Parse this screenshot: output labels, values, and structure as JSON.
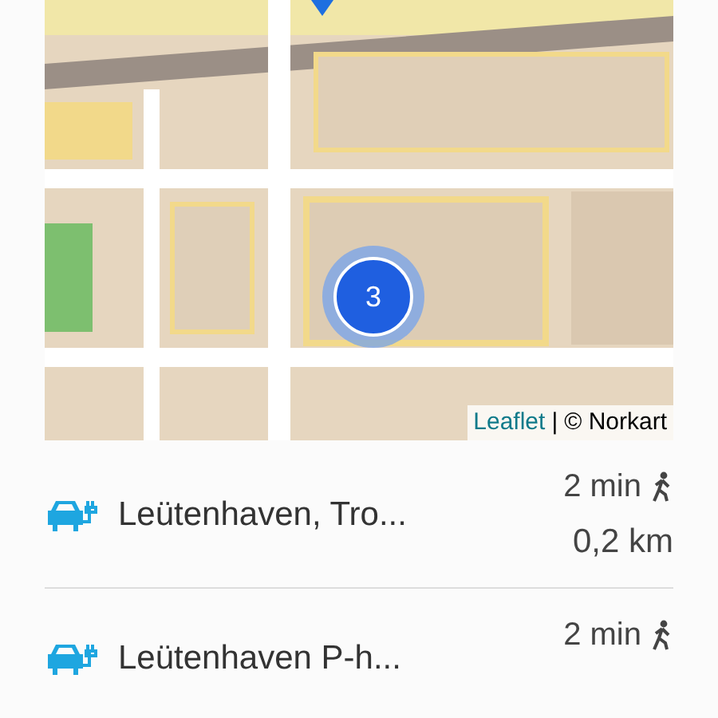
{
  "map": {
    "cluster": {
      "count": "3"
    },
    "attribution": {
      "link": "Leaflet",
      "separator": "|",
      "text": "© Norkart"
    }
  },
  "stations": [
    {
      "name": "Leütenhaven, Tro...",
      "time": "2 min",
      "distance": "0,2 km"
    },
    {
      "name": "Leütenhaven P-h...",
      "time": "2 min"
    }
  ]
}
